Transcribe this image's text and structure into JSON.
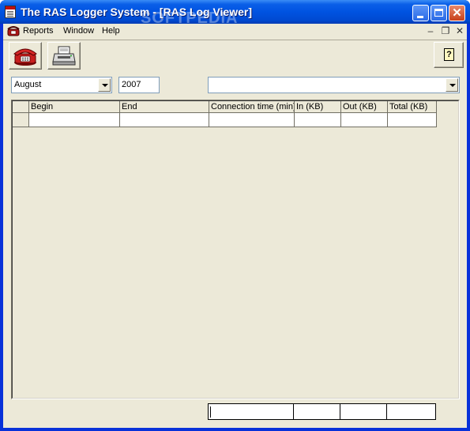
{
  "window": {
    "title": "The RAS Logger System - [RAS Log Viewer]",
    "watermark": "SOFTPEDIA",
    "accent": "#0053e1",
    "close_color": "#c7401b"
  },
  "menu": {
    "items": [
      "Reports",
      "Window",
      "Help"
    ]
  },
  "mdi_controls": [
    "minimize-icon",
    "restore-icon",
    "close-icon"
  ],
  "toolbar": {
    "buttons": [
      "telephone-icon",
      "printer-icon",
      "help-icon"
    ],
    "help_glyph": "?"
  },
  "filters": {
    "month": "August",
    "year": "2007",
    "connection": ""
  },
  "table": {
    "columns": [
      "Begin",
      "End",
      "Connection time (min)",
      "In (KB)",
      "Out (KB)",
      "Total (KB)"
    ],
    "rows": [
      [
        "",
        "",
        "",
        "",
        "",
        ""
      ]
    ]
  },
  "totals": [
    "",
    "",
    "",
    "",
    ""
  ]
}
